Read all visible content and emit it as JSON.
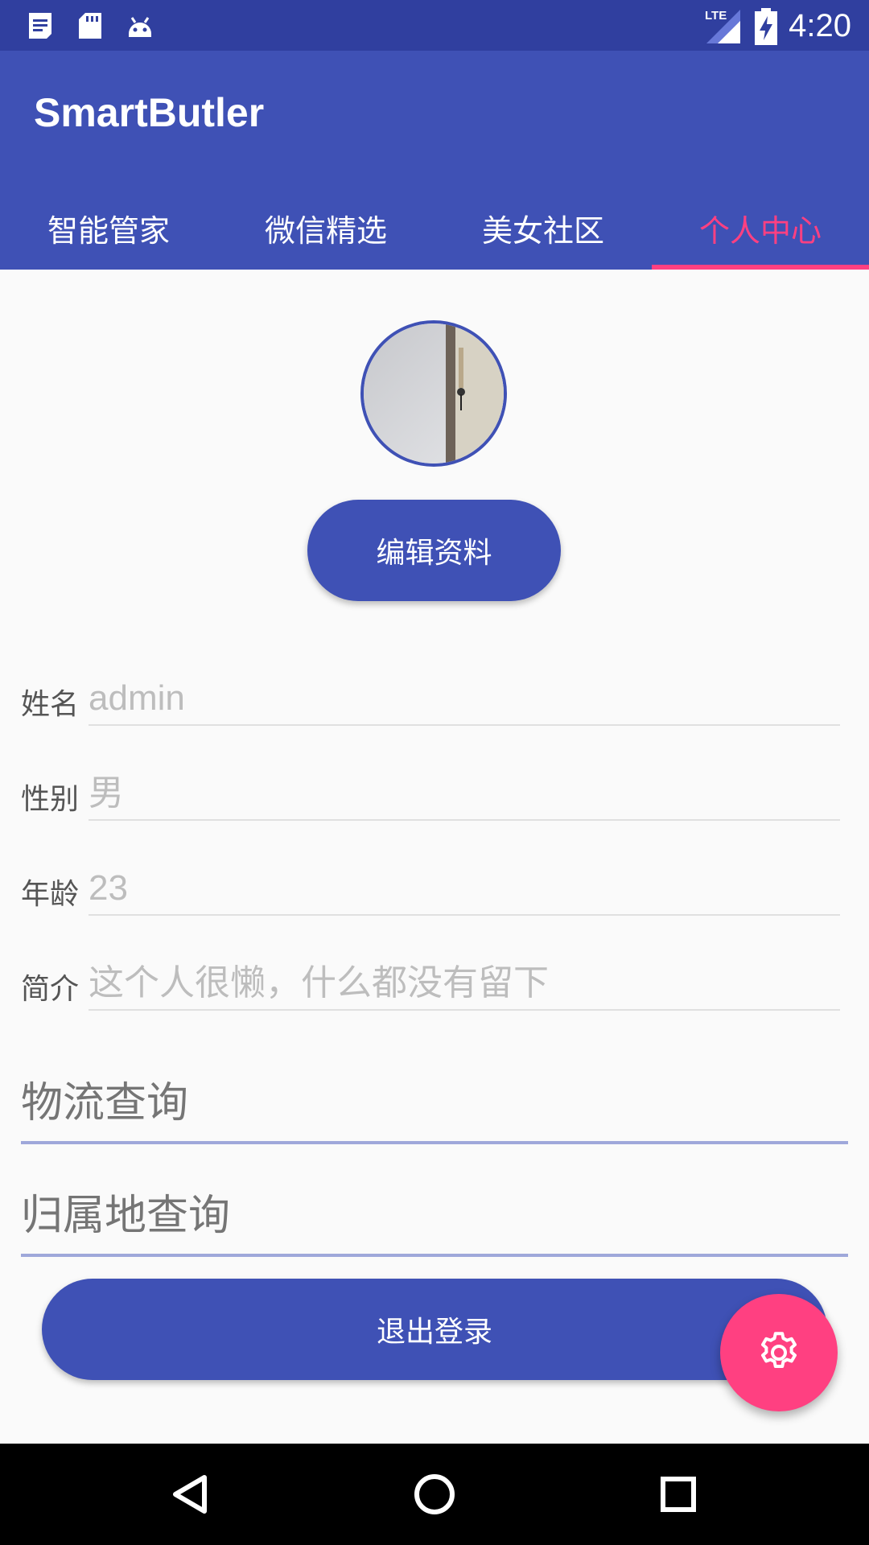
{
  "status_bar": {
    "time": "4:20",
    "left_icons": [
      "notes-icon",
      "sd-card-icon",
      "android-icon"
    ],
    "right_icons": [
      "lte-signal-icon",
      "battery-charging-icon"
    ],
    "lte_label": "LTE"
  },
  "app_bar": {
    "title": "SmartButler",
    "tabs": [
      {
        "label": "智能管家",
        "active": false
      },
      {
        "label": "微信精选",
        "active": false
      },
      {
        "label": "美女社区",
        "active": false
      },
      {
        "label": "个人中心",
        "active": true
      }
    ]
  },
  "profile": {
    "edit_button": "编辑资料",
    "fields": [
      {
        "label": "姓名",
        "value": "admin"
      },
      {
        "label": "性别",
        "value": "男"
      },
      {
        "label": "年龄",
        "value": "23"
      },
      {
        "label": "简介",
        "value": "这个人很懒，什么都没有留下"
      }
    ],
    "logistics_button": "物流查询",
    "location_button": "归属地查询",
    "logout_button": "退出登录"
  },
  "fab": {
    "icon": "gear-icon"
  },
  "colors": {
    "primary": "#3f51b5",
    "primary_dark": "#303f9f",
    "accent": "#ff4081"
  }
}
